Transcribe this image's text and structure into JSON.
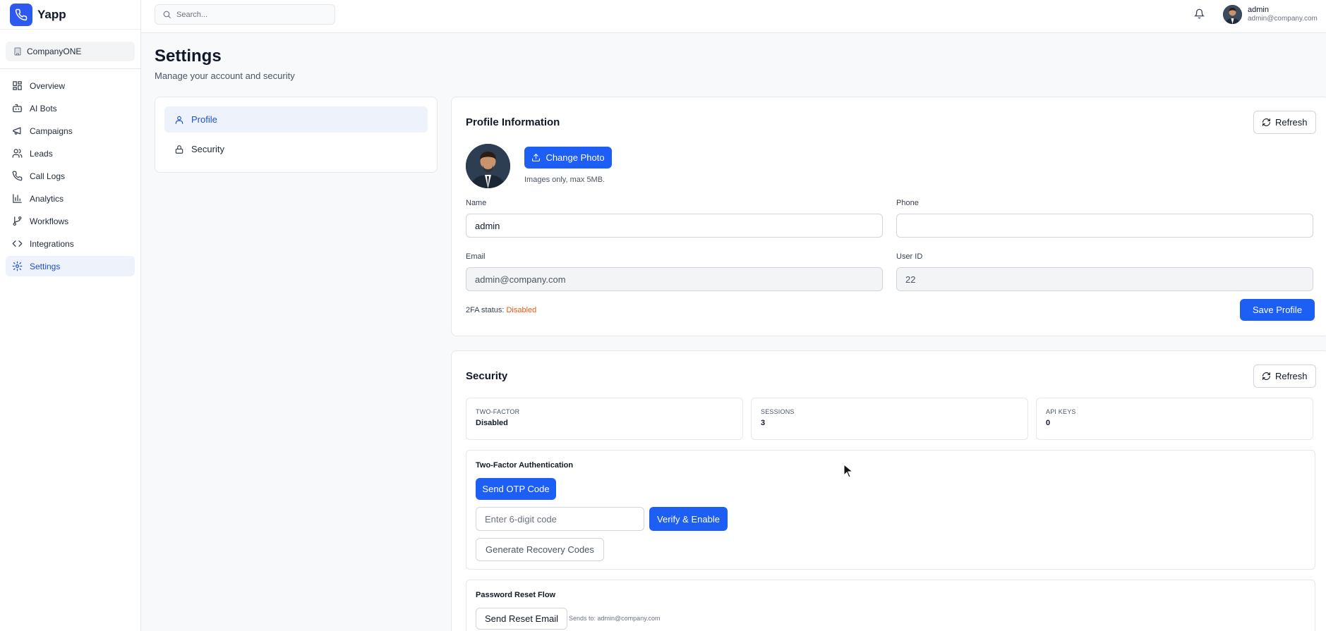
{
  "brand": {
    "name": "Yapp"
  },
  "company": {
    "name": "CompanyONE"
  },
  "nav": [
    {
      "label": "Overview",
      "icon": "grid-icon"
    },
    {
      "label": "AI Bots",
      "icon": "bot-icon"
    },
    {
      "label": "Campaigns",
      "icon": "megaphone-icon"
    },
    {
      "label": "Leads",
      "icon": "users-icon"
    },
    {
      "label": "Call Logs",
      "icon": "phone-icon"
    },
    {
      "label": "Analytics",
      "icon": "bar-chart-icon"
    },
    {
      "label": "Workflows",
      "icon": "git-branch-icon"
    },
    {
      "label": "Integrations",
      "icon": "code-icon"
    },
    {
      "label": "Settings",
      "icon": "gear-icon",
      "active": true
    }
  ],
  "search": {
    "placeholder": "Search..."
  },
  "user": {
    "name": "admin",
    "email": "admin@company.com"
  },
  "page": {
    "title": "Settings",
    "subtitle": "Manage your account and security"
  },
  "tabs": [
    {
      "label": "Profile",
      "icon": "user-icon",
      "active": true
    },
    {
      "label": "Security",
      "icon": "lock-icon"
    }
  ],
  "profile": {
    "title": "Profile Information",
    "refresh_label": "Refresh",
    "change_photo_label": "Change Photo",
    "photo_hint": "Images only, max 5MB.",
    "name_label": "Name",
    "name_value": "admin",
    "phone_label": "Phone",
    "phone_value": "",
    "email_label": "Email",
    "email_value": "admin@company.com",
    "userid_label": "User ID",
    "userid_value": "22",
    "twofa_prefix": "2FA status:",
    "twofa_value": "Disabled",
    "save_label": "Save Profile"
  },
  "security": {
    "title": "Security",
    "refresh_label": "Refresh",
    "stats": [
      {
        "label": "TWO-FACTOR",
        "value": "Disabled"
      },
      {
        "label": "SESSIONS",
        "value": "3"
      },
      {
        "label": "API KEYS",
        "value": "0"
      }
    ],
    "twofa_title": "Two-Factor Authentication",
    "send_otp_label": "Send OTP Code",
    "otp_placeholder": "Enter 6-digit code",
    "verify_label": "Verify & Enable",
    "recovery_label": "Generate Recovery Codes",
    "reset_title": "Password Reset Flow",
    "send_reset_label": "Send Reset Email",
    "sends_to": "Sends to: admin@company.com"
  },
  "colors": {
    "accent": "#1d5ef5",
    "active_bg": "#eef2fb",
    "warning": "#ea580c"
  }
}
